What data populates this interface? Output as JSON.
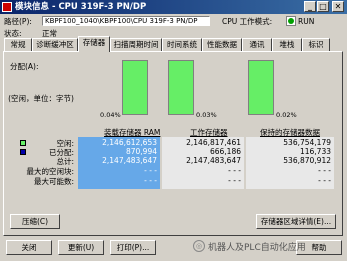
{
  "window": {
    "title": "模块信息 - CPU 319F-3 PN/DP",
    "minimize": "_",
    "maximize": "□",
    "close": "✕"
  },
  "info": {
    "path_label": "路径(P):",
    "path_value": "KBPF100_1040\\KBPF100\\CPU 319F-3 PN/DP",
    "op_mode_label": "CPU 工作模式:",
    "op_mode_value": "RUN",
    "status_label": "状态:",
    "status_value": "正常"
  },
  "tabs": [
    "常规",
    "诊断缓冲区",
    "存储器",
    "扫描周期时间",
    "时间系统",
    "性能数据",
    "通讯",
    "堆栈",
    "标识"
  ],
  "active_tab": 2,
  "memory": {
    "distribution_label": "分配(A):",
    "free_label": "(空闲，单位：字节)",
    "bars": [
      {
        "percent_label": "0.04%",
        "fill": 0.9996
      },
      {
        "percent_label": "0.03%",
        "fill": 0.9997
      },
      {
        "percent_label": "0.02%",
        "fill": 0.9998
      }
    ],
    "headers": [
      "装载存储器 RAM",
      "工作存储器",
      "保持的存储器数据"
    ],
    "row_labels": [
      "空闲:",
      "已分配:",
      "总计:",
      "最大的空闲块:",
      "最大可能数:"
    ],
    "legend": {
      "free_color": "#66ee66",
      "used_color": "#0000aa"
    },
    "columns": [
      [
        "2,146,612,653",
        "870,994",
        "2,147,483,647",
        "- - -",
        "- - -"
      ],
      [
        "2,146,817,461",
        "666,186",
        "2,147,483,647",
        "- - -",
        "- - -"
      ],
      [
        "536,754,179",
        "116,733",
        "536,870,912",
        "- - -",
        "- - -"
      ]
    ]
  },
  "buttons": {
    "compress": "压缩(C)",
    "memory_details": "存储器区域详情(E)...",
    "close": "关闭",
    "update": "更新(U)",
    "print": "打印(P)...",
    "help": "帮助"
  },
  "watermark": "机器人及PLC自动化应用"
}
